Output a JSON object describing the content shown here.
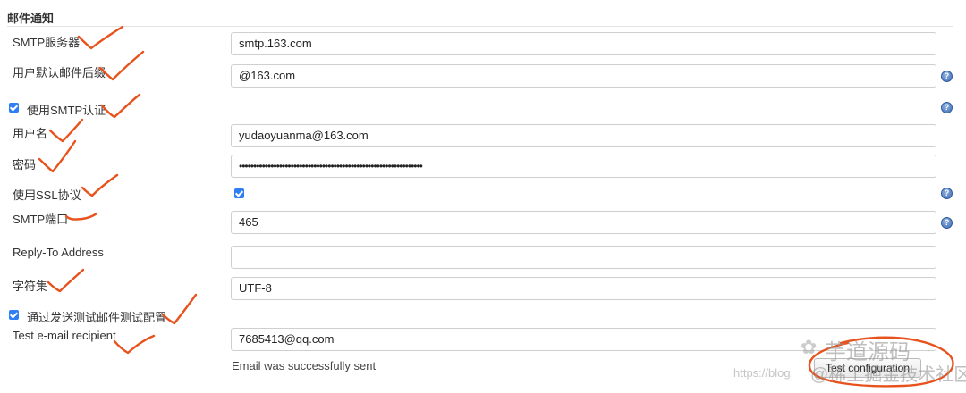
{
  "section": {
    "title": "邮件通知"
  },
  "fields": {
    "smtp_server": {
      "label": "SMTP服务器",
      "value": "smtp.163.com"
    },
    "default_suffix": {
      "label": "用户默认邮件后缀",
      "value": "@163.com"
    },
    "use_smtp_auth": {
      "label": "使用SMTP认证",
      "checked": true
    },
    "username": {
      "label": "用户名",
      "value": "yudaoyuanma@163.com"
    },
    "password": {
      "label": "密码",
      "value": "••••••••••••••••••••••••••••••••••••••••••••••••••••••••••••••••"
    },
    "use_ssl": {
      "label": "使用SSL协议",
      "checked": true
    },
    "smtp_port": {
      "label": "SMTP端口",
      "value": "465"
    },
    "reply_to": {
      "label": "Reply-To Address",
      "value": ""
    },
    "charset": {
      "label": "字符集",
      "value": "UTF-8"
    },
    "test_config": {
      "label": "通过发送测试邮件测试配置",
      "checked": true
    },
    "test_recipient": {
      "label": "Test e-mail recipient",
      "value": "7685413@qq.com"
    }
  },
  "status": {
    "message": "Email was successfully sent"
  },
  "test_button": {
    "label": "Test configuration"
  },
  "help_icon": {
    "glyph": "?"
  },
  "watermark": {
    "brand": "芋道源码",
    "url": "https://blog.",
    "community": "@稀土掘金技术社区"
  },
  "colors": {
    "checkbox": "#2f7ef4",
    "annotation": "#e8521c",
    "help": "#3d6db3"
  }
}
